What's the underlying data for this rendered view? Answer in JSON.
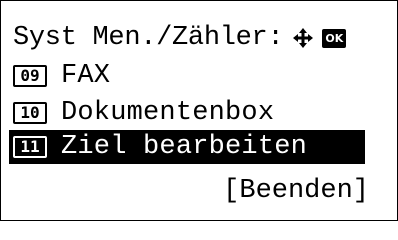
{
  "header": {
    "title": "Syst Men./Zähler:",
    "nav_icon": "four-way-arrow-icon",
    "ok_label": "OK"
  },
  "menu": {
    "items": [
      {
        "number": "09",
        "label": "FAX",
        "selected": false
      },
      {
        "number": "10",
        "label": "Dokumentenbox",
        "selected": false
      },
      {
        "number": "11",
        "label": "Ziel bearbeiten",
        "selected": true
      }
    ]
  },
  "footer": {
    "end_label": "[Beenden]"
  },
  "colors": {
    "background": "#ffffff",
    "foreground": "#000000",
    "highlight_bg": "#000000",
    "highlight_fg": "#ffffff"
  }
}
